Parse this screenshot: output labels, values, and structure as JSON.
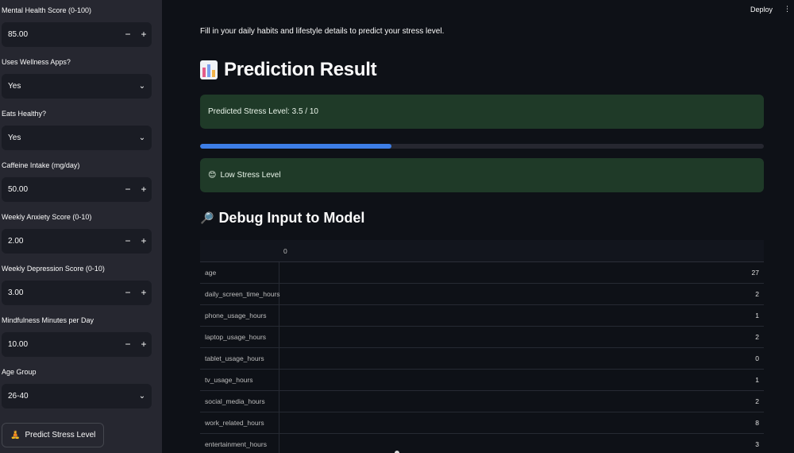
{
  "sidebar": {
    "fields": [
      {
        "label": "Mental Health Score (0-100)",
        "type": "number",
        "value": "85.00"
      },
      {
        "label": "Uses Wellness Apps?",
        "type": "select",
        "value": "Yes"
      },
      {
        "label": "Eats Healthy?",
        "type": "select",
        "value": "Yes"
      },
      {
        "label": "Caffeine Intake (mg/day)",
        "type": "number",
        "value": "50.00"
      },
      {
        "label": "Weekly Anxiety Score (0-10)",
        "type": "number",
        "value": "2.00"
      },
      {
        "label": "Weekly Depression Score (0-10)",
        "type": "number",
        "value": "3.00"
      },
      {
        "label": "Mindfulness Minutes per Day",
        "type": "number",
        "value": "10.00"
      },
      {
        "label": "Age Group",
        "type": "select",
        "value": "26-40"
      }
    ],
    "predict_button": "Predict Stress Level",
    "predict_icon": "🧘",
    "minus": "−",
    "plus": "+",
    "chevron": "⌄"
  },
  "topbar": {
    "deploy": "Deploy",
    "menu": "⋮"
  },
  "main": {
    "intro": "Fill in your daily habits and lifestyle details to predict your stress level.",
    "prediction_title": "Prediction Result",
    "predicted_text": "Predicted Stress Level: 3.5 / 10",
    "progress_fraction": 0.34,
    "stress_badge_emoji": "😊",
    "stress_badge": "Low Stress Level",
    "debug_title": "Debug Input to Model",
    "debug_icon": "🔎",
    "table": {
      "column": "0",
      "rows": [
        {
          "name": "age",
          "value": "27"
        },
        {
          "name": "daily_screen_time_hours",
          "value": "2"
        },
        {
          "name": "phone_usage_hours",
          "value": "1"
        },
        {
          "name": "laptop_usage_hours",
          "value": "2"
        },
        {
          "name": "tablet_usage_hours",
          "value": "0"
        },
        {
          "name": "tv_usage_hours",
          "value": "1"
        },
        {
          "name": "social_media_hours",
          "value": "2"
        },
        {
          "name": "work_related_hours",
          "value": "8"
        },
        {
          "name": "entertainment_hours",
          "value": "3"
        }
      ]
    }
  },
  "colors": {
    "success_bg": "#1f3a28",
    "progress": "#3d7ee6",
    "sidebar_bg": "#262730",
    "app_bg": "#0e1117"
  }
}
